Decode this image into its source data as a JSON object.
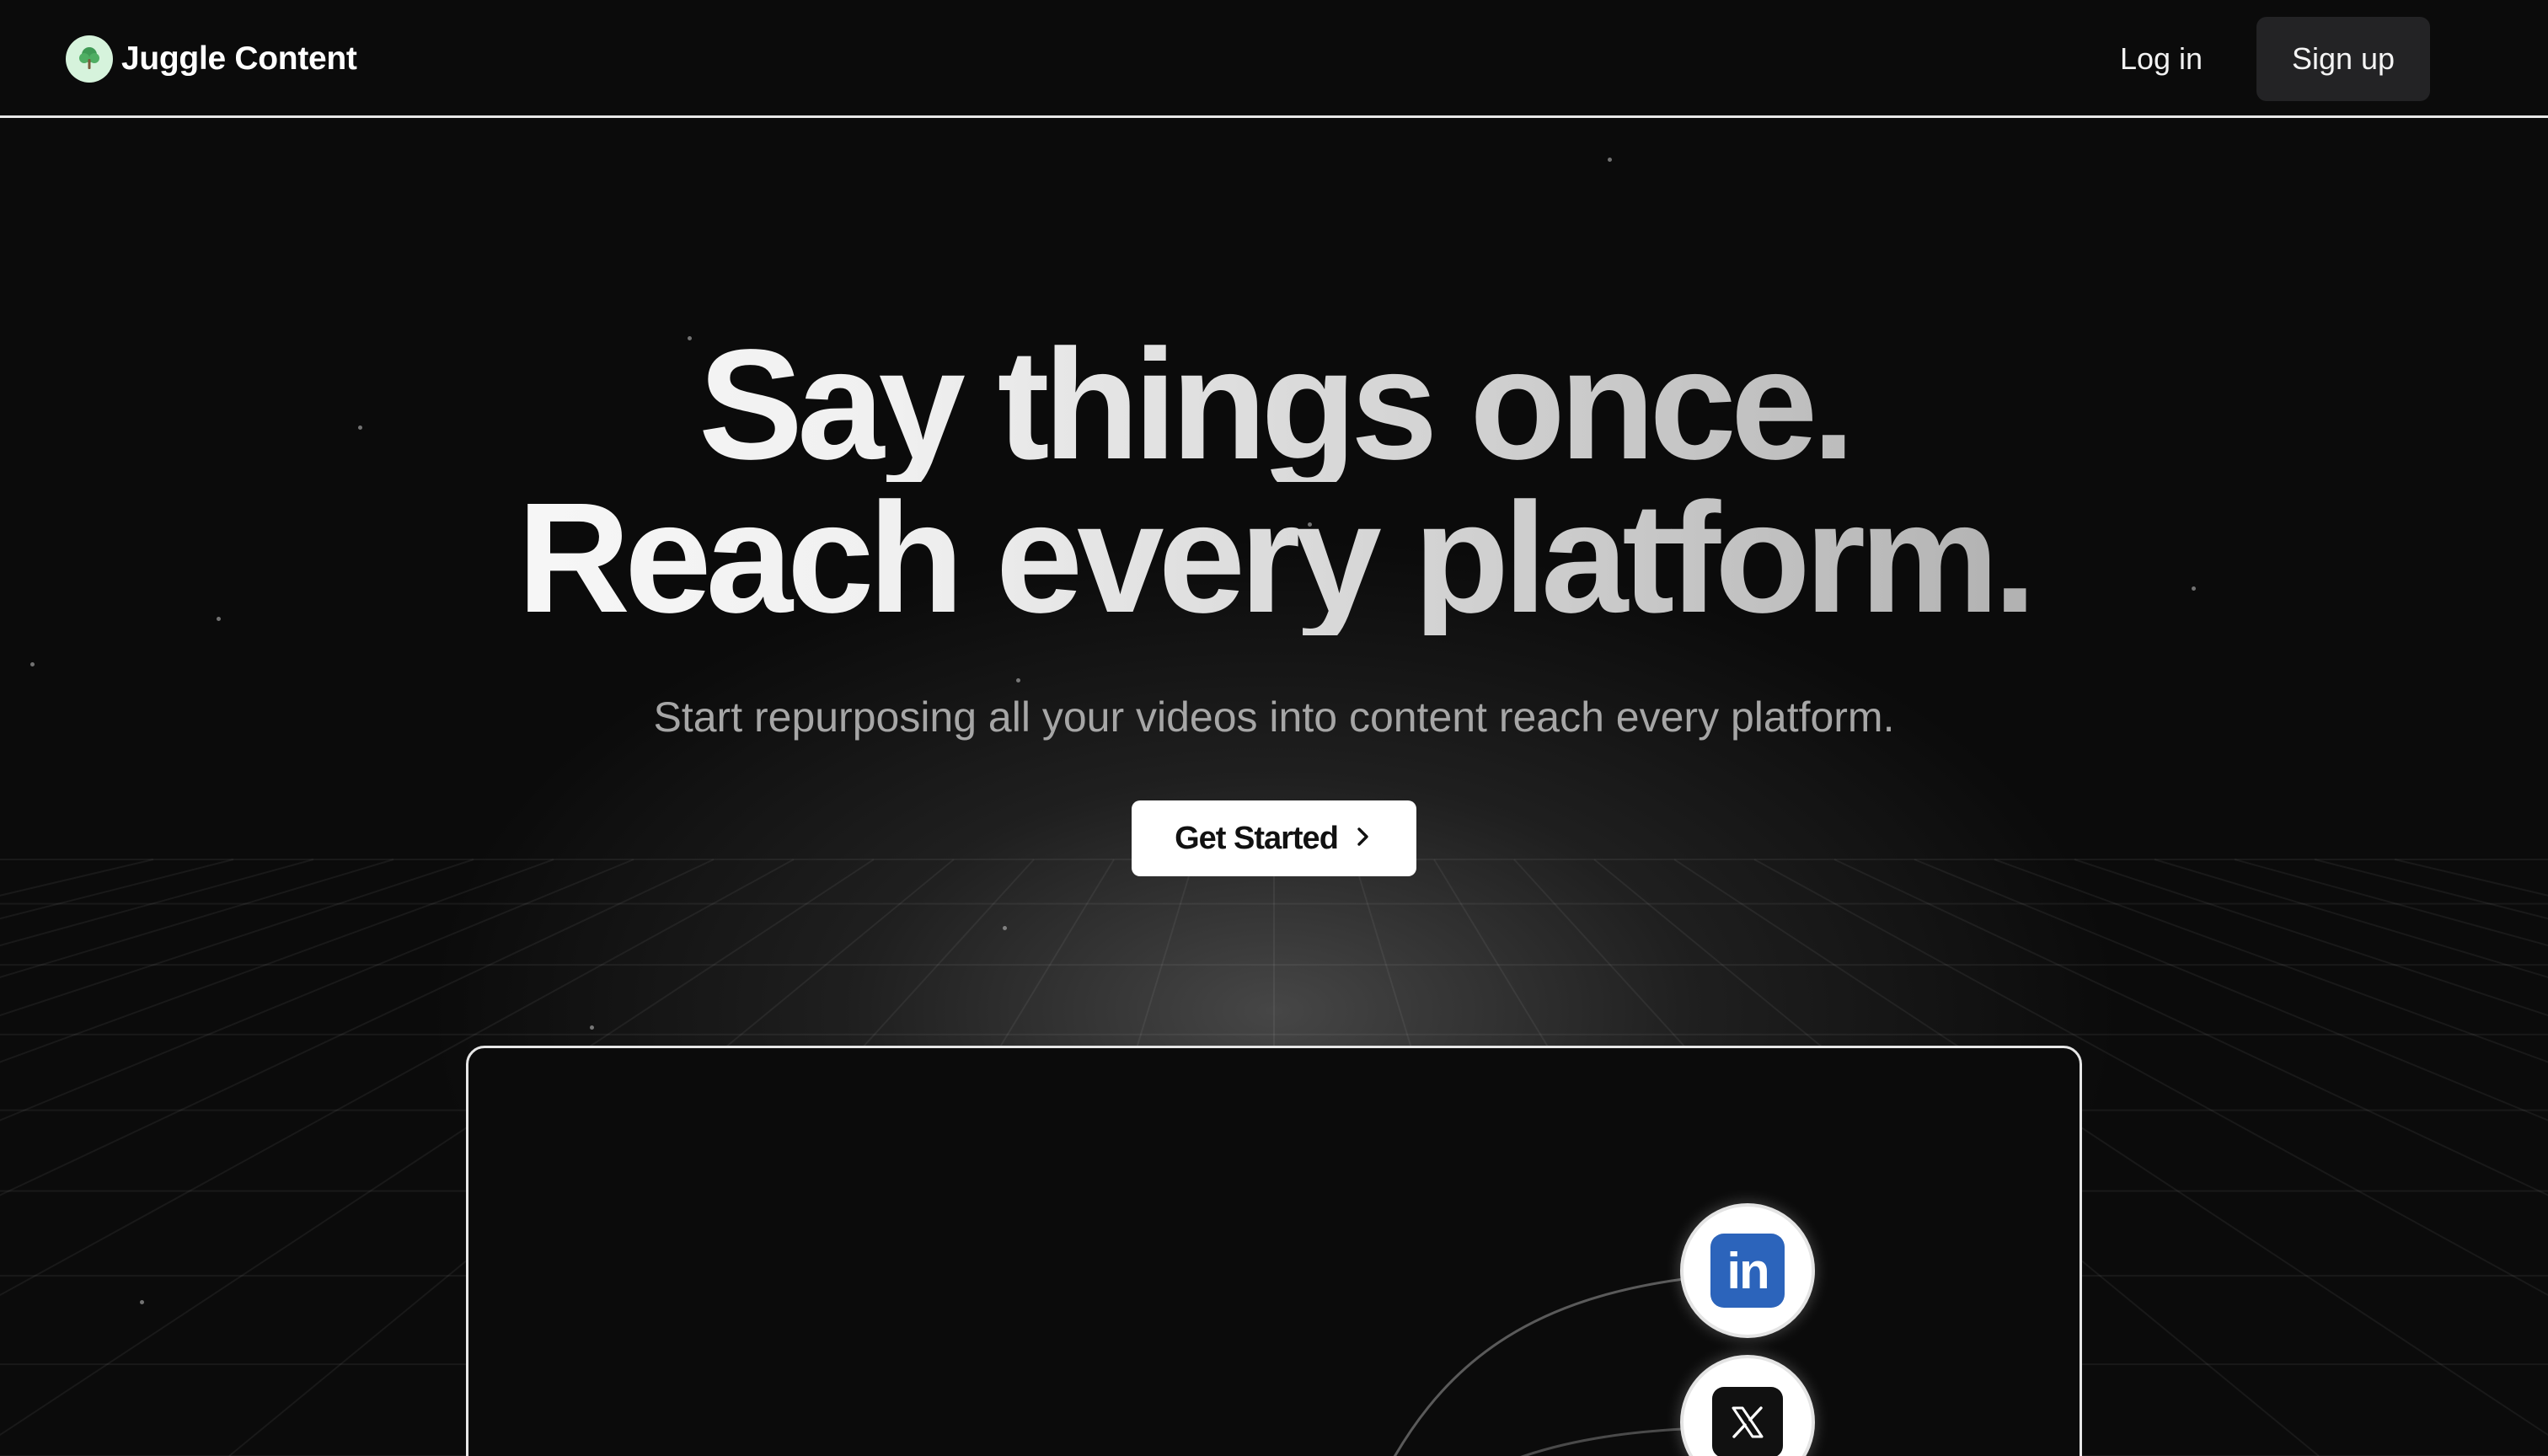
{
  "header": {
    "brand_name": "Juggle Content",
    "login_label": "Log in",
    "signup_label": "Sign up"
  },
  "hero": {
    "title_line1": "Say things once.",
    "title_line2": "Reach every platform.",
    "subtitle": "Start repurposing all your videos into content reach every platform.",
    "cta_label": "Get Started"
  },
  "demo": {
    "platforms": [
      {
        "name": "LinkedIn",
        "icon": "linkedin-icon",
        "glyph": "in"
      },
      {
        "name": "X",
        "icon": "x-icon"
      }
    ]
  },
  "colors": {
    "background": "#0b0b0b",
    "signup_bg": "#232325",
    "linkedin_blue": "#2c64bb",
    "logo_bg": "#d6f3dc",
    "subtitle": "#a6a6a6"
  },
  "icons": {
    "logo": "tree-logo-icon",
    "cta": "chevron-right-icon"
  }
}
